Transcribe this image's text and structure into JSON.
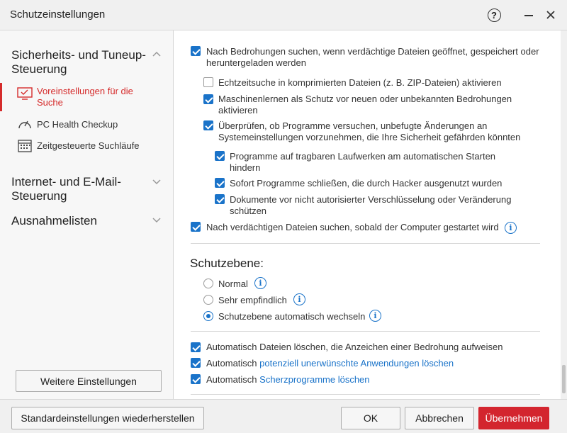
{
  "window": {
    "title": "Schutzeinstellungen"
  },
  "sidebar": {
    "sections": [
      {
        "label": "Sicherheits- und Tuneup-Steuerung"
      },
      {
        "label": "Internet- und E-Mail-Steuerung"
      },
      {
        "label": "Ausnahmelisten"
      }
    ],
    "items": [
      {
        "label": "Voreinstellungen für die Suche"
      },
      {
        "label": "PC Health Checkup"
      },
      {
        "label": "Zeitgesteuerte Suchläufe"
      }
    ],
    "more_button": "Weitere Einstellungen"
  },
  "options": {
    "scan_on_open": "Nach Bedrohungen suchen, wenn verdächtige Dateien geöffnet, gespeichert oder heruntergeladen werden",
    "realtime_zip": "Echtzeitsuche in komprimierten Dateien (z. B. ZIP-Dateien) aktivieren",
    "ml": "Maschinenlernen als Schutz vor neuen oder unbekannten Bedrohungen aktivieren",
    "check_programs": "Überprüfen, ob Programme versuchen, unbefugte Änderungen an Systemeinstellungen vorzunehmen, die Ihre Sicherheit gefährden könnten",
    "portable_drives": "Programme auf tragbaren Laufwerken am automatischen Starten hindern",
    "close_programs": "Sofort Programme schließen, die durch Hacker ausgenutzt wurden",
    "protect_docs": "Dokumente vor nicht autorisierter Verschlüsselung oder Veränderung schützen",
    "scan_startup": "Nach verdächtigen Dateien suchen, sobald der Computer gestartet wird"
  },
  "protection_level": {
    "title": "Schutzebene:",
    "normal": "Normal",
    "sensitive": "Sehr empfindlich",
    "auto": "Schutzebene automatisch wechseln"
  },
  "auto_delete": {
    "files": "Automatisch Dateien löschen, die Anzeichen einer Bedrohung aufweisen",
    "pua_prefix": "Automatisch ",
    "pua_link": "potenziell unerwünschte Anwendungen löschen",
    "joke_prefix": "Automatisch ",
    "joke_link": "Scherzprogramme löschen"
  },
  "footer": {
    "restore": "Standardeinstellungen wiederherstellen",
    "ok": "OK",
    "cancel": "Abbrechen",
    "apply": "Übernehmen"
  },
  "colors": {
    "accent": "#1a73c9",
    "brand": "#d3252e"
  }
}
